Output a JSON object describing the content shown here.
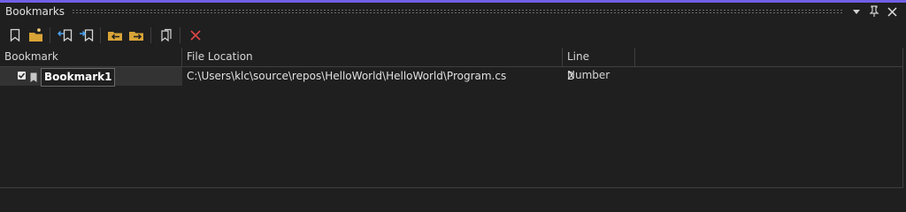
{
  "window": {
    "title": "Bookmarks",
    "accent_color": "#7160e8"
  },
  "title_buttons": [
    "window-position-icon",
    "pin-icon",
    "close-icon"
  ],
  "toolbar": {
    "tools": [
      "toggle-bookmark-icon",
      "new-bookmark-folder-icon",
      "previous-bookmark-icon",
      "next-bookmark-icon",
      "previous-bookmark-in-folder-icon",
      "next-bookmark-in-folder-icon",
      "disable-all-bookmarks-icon",
      "delete-bookmark-icon"
    ]
  },
  "table": {
    "columns": [
      "Bookmark",
      "File Location",
      "Line Number"
    ],
    "rows": [
      {
        "checked": true,
        "bookmark": "Bookmark1",
        "file": "C:\\Users\\klc\\source\\repos\\HelloWorld\\HelloWorld\\Program.cs",
        "line": "2"
      }
    ]
  }
}
